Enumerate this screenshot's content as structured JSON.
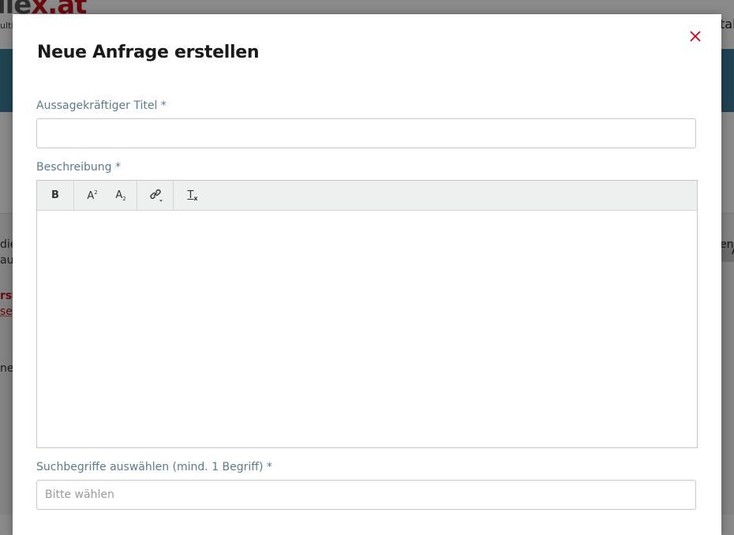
{
  "background": {
    "logo_gray": "lle",
    "logo_red": "x.at",
    "logo_sub": "ulti",
    "nav_right": "tak",
    "right_button": "A",
    "left_text_1": "die",
    "left_text_2": "au",
    "left_red_1": "rst",
    "left_red_2": "se",
    "left_text_3": "ne",
    "right_text": "ens"
  },
  "modal": {
    "title": "Neue Anfrage erstellen",
    "close_icon": "close-icon",
    "accent_color": "#d0021b",
    "title_field": {
      "label": "Aussagekräftiger Titel *",
      "value": "",
      "placeholder": ""
    },
    "description_field": {
      "label": "Beschreibung *",
      "toolbar": {
        "bold": "B",
        "superscript_base": "A",
        "superscript_mark": "2",
        "subscript_base": "A",
        "subscript_mark": "2",
        "link_icon": "link-icon",
        "clear_format_base": "T",
        "clear_format_mark": "x"
      },
      "content": ""
    },
    "search_terms_field": {
      "label": "Suchbegriffe auswählen (mind. 1 Begriff) *",
      "placeholder": "Bitte wählen"
    }
  }
}
